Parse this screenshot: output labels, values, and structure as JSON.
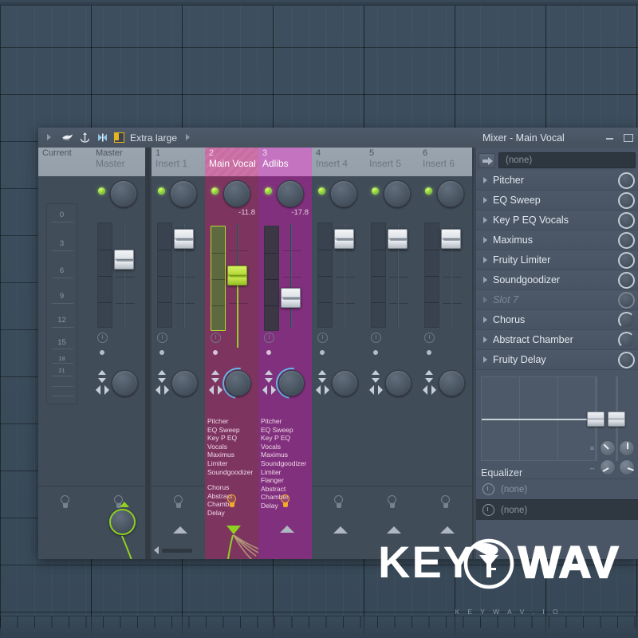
{
  "window": {
    "toolbar_label": "Extra large",
    "title": "Mixer - Main Vocal",
    "icons": [
      "play-arrow-icon",
      "bird-icon",
      "anchor-icon",
      "hourglass-icon",
      "square-toggle-icon",
      "chevron-right-icon"
    ],
    "minimize": "minimize-icon",
    "maximize": "maximize-icon"
  },
  "current_panel": {
    "header_num": "Current",
    "header_name": "",
    "scale_labels": [
      "0",
      "3",
      "6",
      "9",
      "12",
      "15",
      "18",
      "21"
    ]
  },
  "strips": [
    {
      "num": "Master",
      "name": "Master",
      "db": "",
      "selected": false,
      "color": "#414c59",
      "fader_green": false,
      "plugins": [],
      "plugins2": [],
      "bulb_on": false,
      "send_knob": true
    },
    {
      "num": "1",
      "name": "Insert 1",
      "db": "",
      "selected": false,
      "color": "#414c59",
      "fader_green": false,
      "plugins": [],
      "plugins2": [],
      "bulb_on": false,
      "send_knob": false
    },
    {
      "num": "2",
      "name": "Main Vocal",
      "db": "-11.8",
      "selected": true,
      "color": "#7d3560",
      "fader_green": true,
      "plugins": [
        "Pitcher",
        "EQ Sweep",
        "Key P EQ Vocals",
        "Maximus",
        "Limiter",
        "Soundgoodizer"
      ],
      "plugins2": [
        "Chorus",
        "Abstract Chamber",
        "Delay"
      ],
      "bulb_on": true,
      "send_knob": false
    },
    {
      "num": "3",
      "name": "Adlibs",
      "db": "-17.8",
      "selected": true,
      "color": "#80307c",
      "fader_green": false,
      "plugins": [
        "Pitcher",
        "EQ Sweep",
        "Key P EQ Vocals",
        "Maximus",
        "Soundgoodizer",
        "Limiter",
        "Flanger"
      ],
      "plugins2": [
        "Abstract Chamber",
        "Delay"
      ],
      "bulb_on": true,
      "send_knob": false
    },
    {
      "num": "4",
      "name": "Insert 4",
      "db": "",
      "selected": false,
      "color": "#414c59",
      "fader_green": false,
      "plugins": [],
      "plugins2": [],
      "bulb_on": false,
      "send_knob": false
    },
    {
      "num": "5",
      "name": "Insert 5",
      "db": "",
      "selected": false,
      "color": "#414c59",
      "fader_green": false,
      "plugins": [],
      "plugins2": [],
      "bulb_on": false,
      "send_knob": false
    },
    {
      "num": "6",
      "name": "Insert 6",
      "db": "",
      "selected": false,
      "color": "#414c59",
      "fader_green": false,
      "plugins": [],
      "plugins2": [],
      "bulb_on": false,
      "send_knob": false
    }
  ],
  "rack": {
    "input_value": "(none)",
    "slots": [
      {
        "label": "Pitcher",
        "empty": false,
        "knob": "full"
      },
      {
        "label": "EQ Sweep",
        "empty": false,
        "knob": "full"
      },
      {
        "label": "Key P EQ Vocals",
        "empty": false,
        "knob": "full"
      },
      {
        "label": "Maximus",
        "empty": false,
        "knob": "full"
      },
      {
        "label": "Fruity Limiter",
        "empty": false,
        "knob": "full"
      },
      {
        "label": "Soundgoodizer",
        "empty": false,
        "knob": "full"
      },
      {
        "label": "Slot 7",
        "empty": true,
        "knob": "dim"
      },
      {
        "label": "Chorus",
        "empty": false,
        "knob": "partial"
      },
      {
        "label": "Abstract Chamber",
        "empty": false,
        "knob": "partial"
      },
      {
        "label": "Fruity Delay",
        "empty": false,
        "knob": "full"
      }
    ],
    "equalizer_label": "Equalizer",
    "output_value": "(none)",
    "output_value2": "(none)"
  },
  "watermark": {
    "key": "KEY",
    "wav": "WAV",
    "sub": "K E Y W A V . I O"
  },
  "colors": {
    "accent_green": "#8fd020",
    "selected_pink": "#cd73a8",
    "selected_magenta": "#c473c0",
    "window_bg": "#4a5665",
    "strip_bg": "#414c59",
    "playlist_bg": "#3b4c5c",
    "amber": "#f0a92b"
  }
}
